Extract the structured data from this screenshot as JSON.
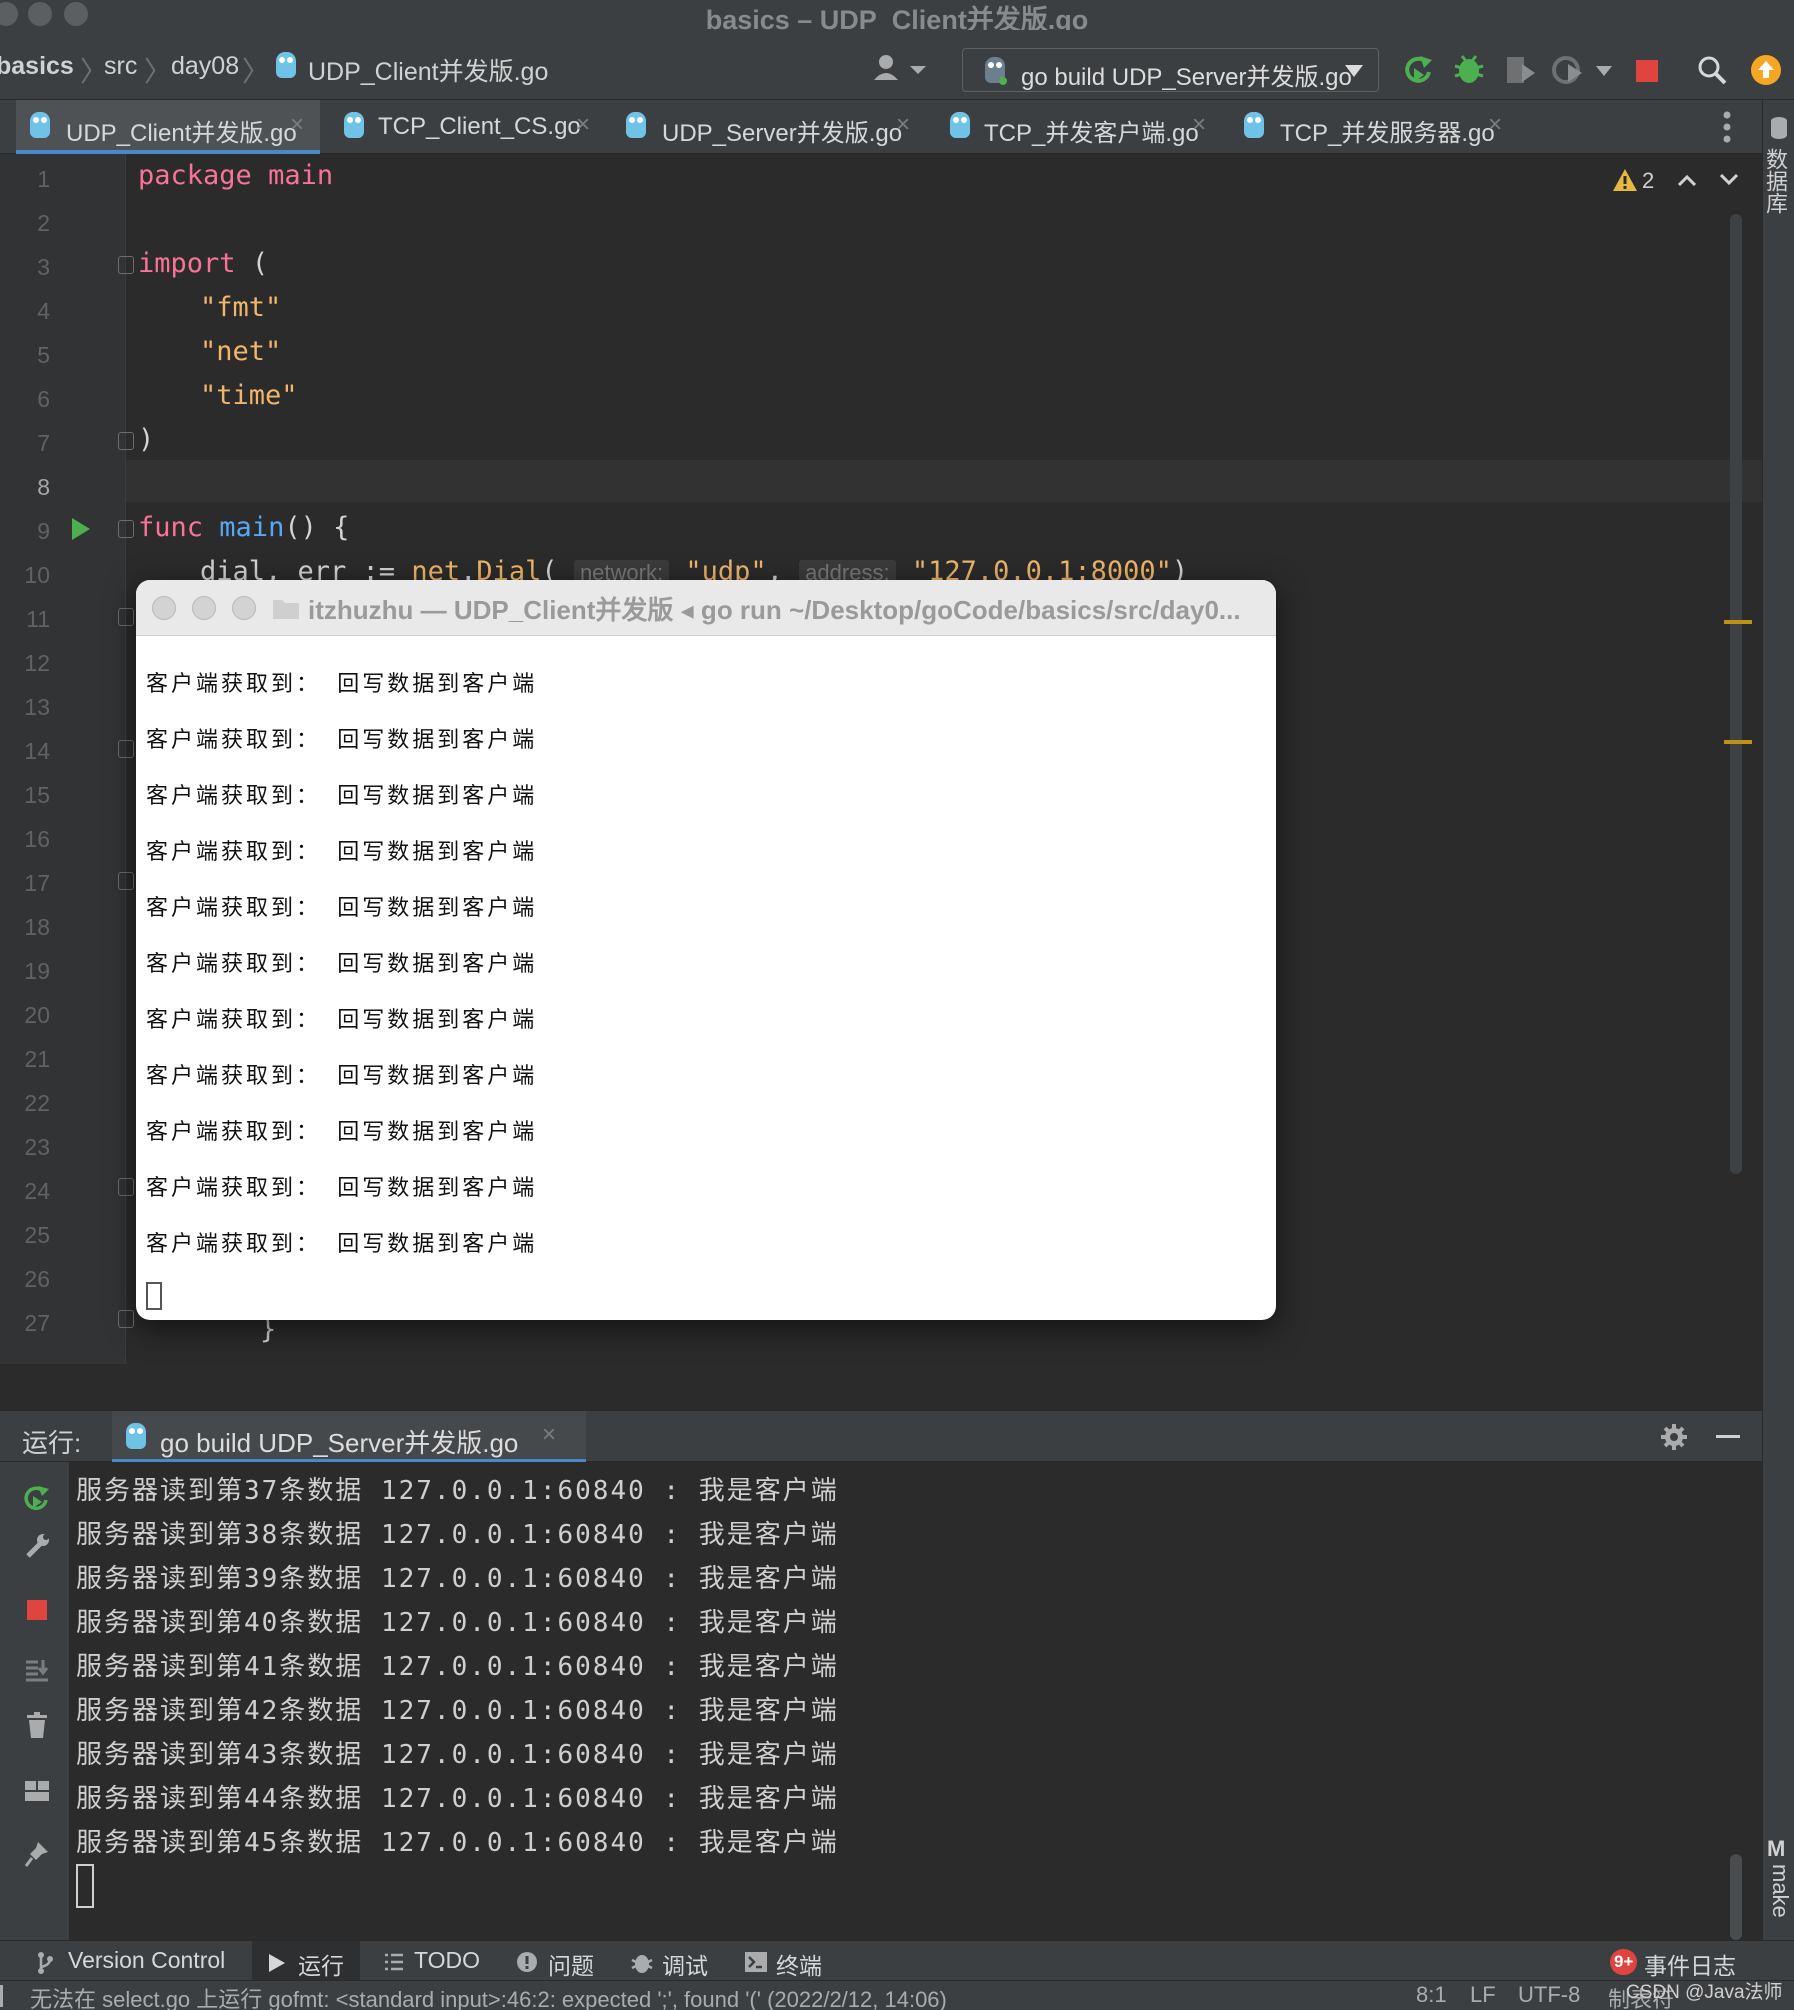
{
  "window": {
    "title": "basics – UDP_Client并发版.go"
  },
  "breadcrumb": [
    "basics",
    "src",
    "day08",
    "UDP_Client并发版.go"
  ],
  "run_config": {
    "label": "go build UDP_Server并发版.go"
  },
  "tabs": [
    {
      "label": "UDP_Client并发版.go",
      "active": true
    },
    {
      "label": "TCP_Client_CS.go",
      "active": false
    },
    {
      "label": "UDP_Server并发版.go",
      "active": false
    },
    {
      "label": "TCP_并发客户端.go",
      "active": false
    },
    {
      "label": "TCP_并发服务器.go",
      "active": false
    }
  ],
  "editor": {
    "warnings_count": "2",
    "line_numbers": [
      "1",
      "2",
      "3",
      "4",
      "5",
      "6",
      "7",
      "8",
      "9",
      "10",
      "11",
      "12",
      "13",
      "14",
      "15",
      "16",
      "17",
      "18",
      "19",
      "20",
      "21",
      "22",
      "23",
      "24",
      "25",
      "26",
      "27"
    ],
    "code": {
      "l1_kw": "package",
      "l1_name": "main",
      "l3_kw": "import",
      "l3_paren": "(",
      "l4": "\"fmt\"",
      "l5": "\"net\"",
      "l6": "\"time\"",
      "l7": ")",
      "l9_kw": "func",
      "l9_fn": "main",
      "l9_rest": "() {",
      "l10_a": "dial, err := ",
      "l10_pkg": "net",
      "l10_dot": ".",
      "l10_fn": "Dial",
      "l10_open": "(",
      "l10_hint1": "network:",
      "l10_s1": "\"udp\"",
      "l10_comma": ",",
      "l10_hint2": "address:",
      "l10_s2": "\"127.0.0.1:8000\"",
      "l10_close": ")",
      "l27": "}"
    }
  },
  "terminal": {
    "title": "itzhuzhu — UDP_Client并发版 ◂ go run ~/Desktop/goCode/basics/src/day0...",
    "lines": [
      "客户端获取到： 回写数据到客户端",
      "客户端获取到： 回写数据到客户端",
      "客户端获取到： 回写数据到客户端",
      "客户端获取到： 回写数据到客户端",
      "客户端获取到： 回写数据到客户端",
      "客户端获取到： 回写数据到客户端",
      "客户端获取到： 回写数据到客户端",
      "客户端获取到： 回写数据到客户端",
      "客户端获取到： 回写数据到客户端",
      "客户端获取到： 回写数据到客户端",
      "客户端获取到： 回写数据到客户端"
    ]
  },
  "run_panel": {
    "label": "运行:",
    "tab_label": "go build UDP_Server并发版.go",
    "output": [
      "服务器读到第37条数据 127.0.0.1:60840 : 我是客户端",
      "服务器读到第38条数据 127.0.0.1:60840 : 我是客户端",
      "服务器读到第39条数据 127.0.0.1:60840 : 我是客户端",
      "服务器读到第40条数据 127.0.0.1:60840 : 我是客户端",
      "服务器读到第41条数据 127.0.0.1:60840 : 我是客户端",
      "服务器读到第42条数据 127.0.0.1:60840 : 我是客户端",
      "服务器读到第43条数据 127.0.0.1:60840 : 我是客户端",
      "服务器读到第44条数据 127.0.0.1:60840 : 我是客户端",
      "服务器读到第45条数据 127.0.0.1:60840 : 我是客户端"
    ]
  },
  "right_strip": {
    "database": "数据库",
    "make": "make"
  },
  "tool_windows": {
    "version_control": "Version Control",
    "run": "运行",
    "todo": "TODO",
    "problems": "问题",
    "debug": "调试",
    "terminal": "终端",
    "event_log": "事件日志",
    "event_badge": "9+"
  },
  "status_bar": {
    "message": "无法在 select.go 上运行 gofmt: <standard input>:46:2: expected ';', found '(' (2022/2/12, 14:06)",
    "position": "8:1",
    "line_sep": "LF",
    "encoding": "UTF-8",
    "indent": "制表符",
    "watermark": "CSDN @Java法师"
  },
  "colors": {
    "ide_bg": "#2b2b2b",
    "panel_bg": "#3c3f41",
    "keyword": "#f87397",
    "string": "#f0b66a",
    "function": "#56a8f5",
    "accent": "#4a88c7",
    "run_green": "#4caf50",
    "stop_red": "#e0443e"
  },
  "icons": [
    "user-icon",
    "gopher-icon",
    "rerun-icon",
    "debug-icon",
    "coverage-icon",
    "profile-icon",
    "stop-icon",
    "search-icon",
    "update-icon",
    "warning-icon",
    "more-icon",
    "settings-icon",
    "minimize-icon",
    "wrench-icon",
    "scroll-end-icon",
    "trash-icon",
    "layout-icon",
    "pin-icon",
    "run-triangle-icon"
  ]
}
